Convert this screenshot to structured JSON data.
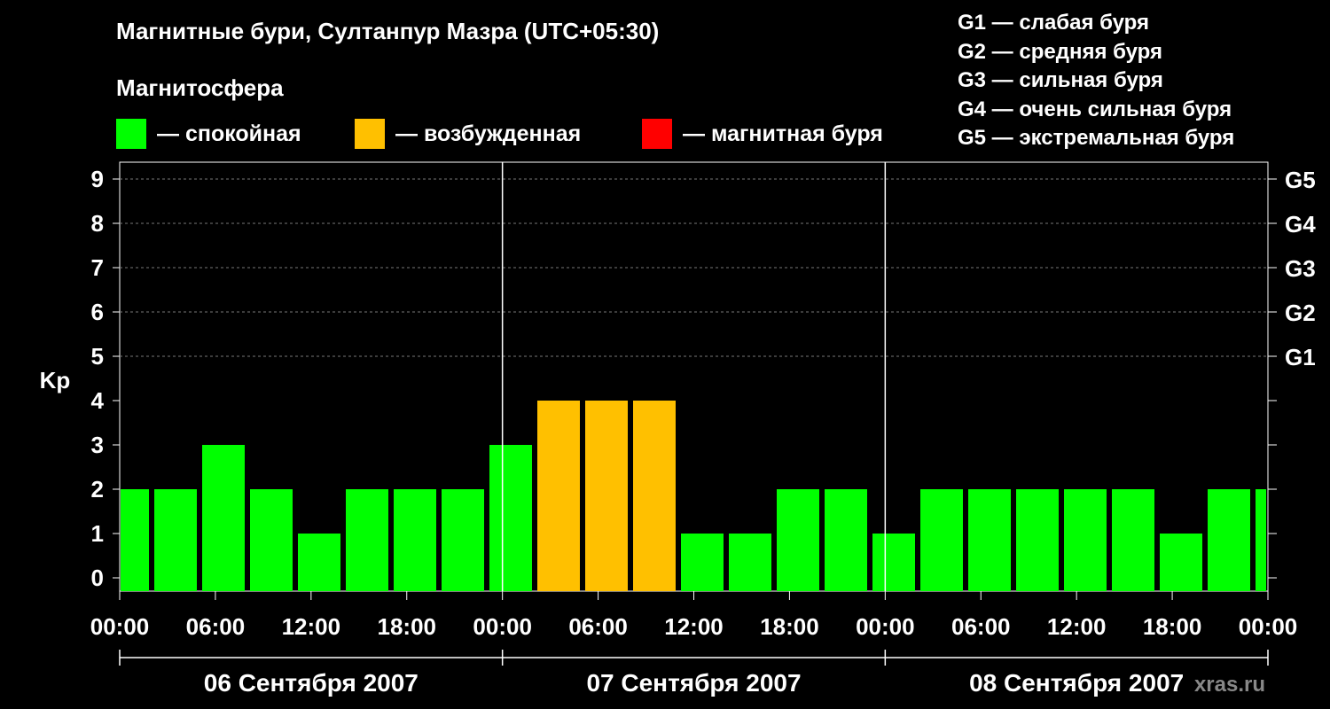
{
  "title": "Магнитные бури, Султанпур Мазра (UTC+05:30)",
  "subtitle": "Магнитосфера",
  "legend": [
    {
      "label": "— спокойная",
      "color": "#00ff00"
    },
    {
      "label": "— возбужденная",
      "color": "#ffc000"
    },
    {
      "label": "— магнитная буря",
      "color": "#ff0000"
    }
  ],
  "g_scale": [
    "G1 — слабая буря",
    "G2 — средняя буря",
    "G3 — сильная буря",
    "G4 — очень сильная буря",
    "G5 — экстремальная буря"
  ],
  "watermark": "xras.ru",
  "chart_data": {
    "type": "bar",
    "ylabel": "Kp",
    "ylim": [
      0,
      9
    ],
    "yticks": [
      "0",
      "1",
      "2",
      "3",
      "4",
      "5",
      "6",
      "7",
      "8",
      "9"
    ],
    "right_ticks": [
      {
        "kp": 5,
        "label": "G1"
      },
      {
        "kp": 6,
        "label": "G2"
      },
      {
        "kp": 7,
        "label": "G3"
      },
      {
        "kp": 8,
        "label": "G4"
      },
      {
        "kp": 9,
        "label": "G5"
      }
    ],
    "xtick_labels": [
      "00:00",
      "06:00",
      "12:00",
      "18:00",
      "00:00",
      "06:00",
      "12:00",
      "18:00",
      "00:00",
      "06:00",
      "12:00",
      "18:00",
      "00:00"
    ],
    "days": [
      "06 Сентября 2007",
      "07 Сентября 2007",
      "08 Сентября 2007"
    ],
    "values": [
      2,
      2,
      3,
      2,
      1,
      2,
      2,
      2,
      3,
      4,
      4,
      4,
      1,
      1,
      2,
      2,
      1,
      2,
      2,
      2,
      2,
      2,
      1,
      2,
      2
    ],
    "colors": {
      "quiet": "#00ff00",
      "active": "#ffc000",
      "storm": "#ff0000"
    },
    "grid": true
  }
}
